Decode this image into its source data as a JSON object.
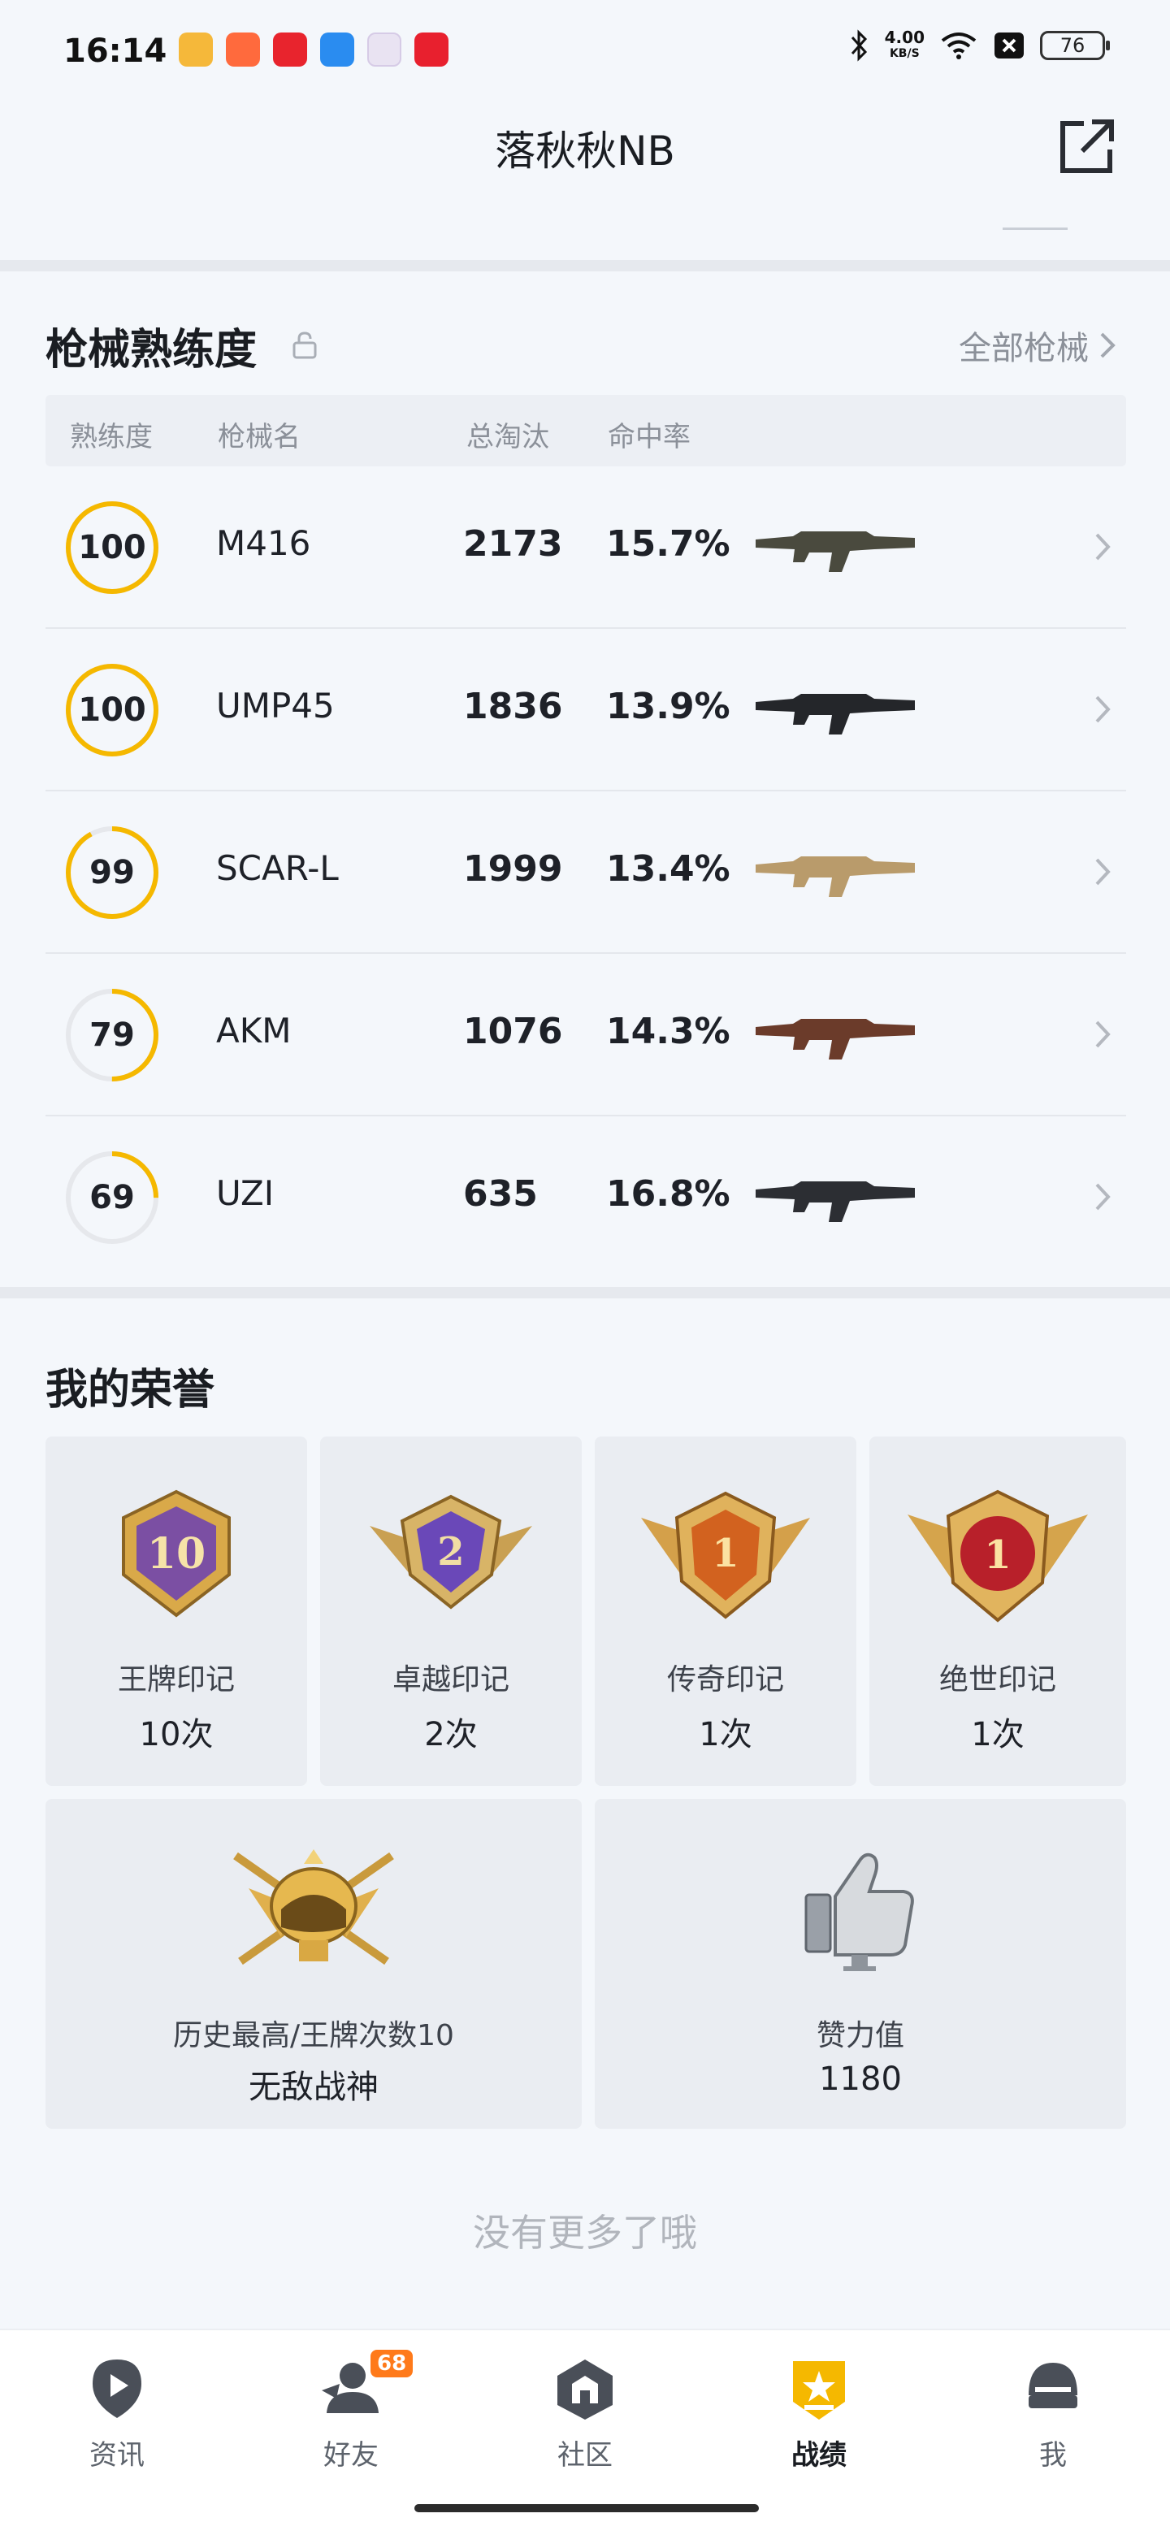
{
  "status_bar": {
    "time": "16:14",
    "net_speed": "4.00",
    "net_unit": "KB/S",
    "battery": "76",
    "app_icons": [
      {
        "name": "books-app-icon",
        "color": "#f5b83a"
      },
      {
        "name": "game-app-icon",
        "color": "#ff6a3d"
      },
      {
        "name": "shop-app-icon",
        "color": "#e8242d"
      },
      {
        "name": "files-app-icon",
        "color": "#2a8cf0"
      },
      {
        "name": "photos-app-icon",
        "color": "#e9e3f2"
      },
      {
        "name": "music-app-icon",
        "color": "#e8202e"
      }
    ]
  },
  "header": {
    "title": "落秋秋NB",
    "share_icon": "share-icon"
  },
  "weapons": {
    "title": "枪械熟练度",
    "all_link": "全部枪械",
    "columns": [
      "熟练度",
      "枪械名",
      "总淘汰",
      "命中率"
    ],
    "rows": [
      {
        "level": "100",
        "progress": 1.0,
        "name": "M416",
        "kills": "2173",
        "accuracy": "15.7%",
        "gun_color": "#4a4a3e"
      },
      {
        "level": "100",
        "progress": 1.0,
        "name": "UMP45",
        "kills": "1836",
        "accuracy": "13.9%",
        "gun_color": "#24262a"
      },
      {
        "level": "99",
        "progress": 0.92,
        "name": "SCAR-L",
        "kills": "1999",
        "accuracy": "13.4%",
        "gun_color": "#b99b6b"
      },
      {
        "level": "79",
        "progress": 0.5,
        "name": "AKM",
        "kills": "1076",
        "accuracy": "14.3%",
        "gun_color": "#6b3b2a"
      },
      {
        "level": "69",
        "progress": 0.25,
        "name": "UZI",
        "kills": "635",
        "accuracy": "16.8%",
        "gun_color": "#2c2e33"
      }
    ]
  },
  "honors": {
    "title": "我的荣誉",
    "items": [
      {
        "name": "王牌印记",
        "count": "10次",
        "badge_num": "10",
        "color": "#7b4fa3"
      },
      {
        "name": "卓越印记",
        "count": "2次",
        "badge_num": "2",
        "color": "#6a48b8"
      },
      {
        "name": "传奇印记",
        "count": "1次",
        "badge_num": "1",
        "color": "#d2621f"
      },
      {
        "name": "绝世印记",
        "count": "1次",
        "badge_num": "1",
        "color": "#b8202a"
      }
    ],
    "highest_label": "历史最高/王牌次数10",
    "highest_value": "无敌战神",
    "likes_label": "赞力值",
    "likes_value": "1180"
  },
  "footer": {
    "no_more": "没有更多了哦"
  },
  "nav": {
    "items": [
      {
        "label": "资讯",
        "icon": "news-icon"
      },
      {
        "label": "好友",
        "icon": "friends-icon",
        "badge": "68"
      },
      {
        "label": "社区",
        "icon": "community-icon"
      },
      {
        "label": "战绩",
        "icon": "stats-icon"
      },
      {
        "label": "我",
        "icon": "profile-icon"
      }
    ]
  },
  "colors": {
    "accent": "#f5b800",
    "ring_track": "#e6e8ec",
    "nav_badge": "#ff7a1a"
  }
}
